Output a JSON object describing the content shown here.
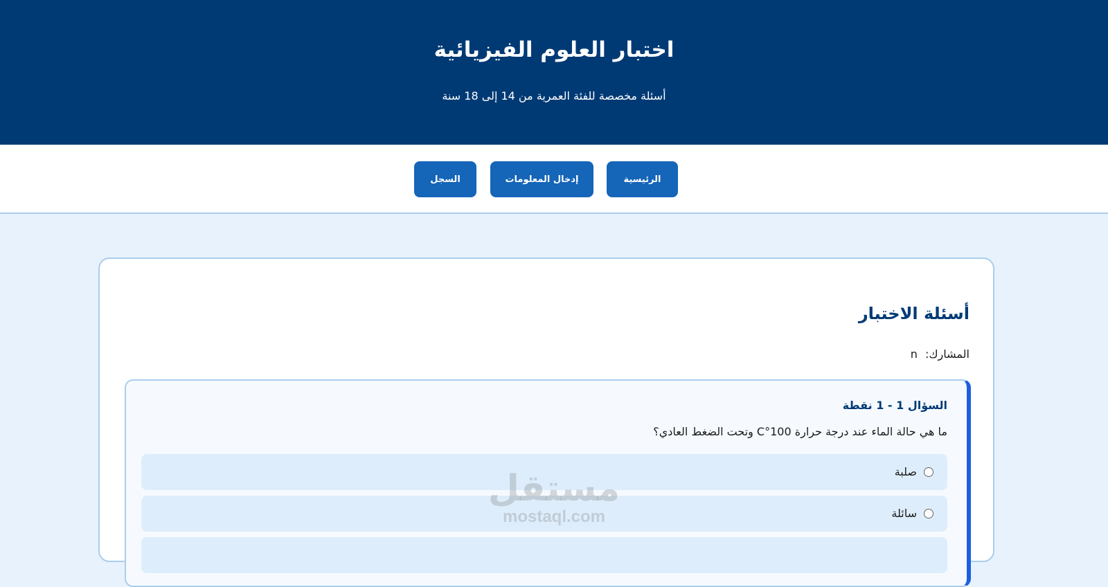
{
  "header": {
    "title": "اختبار العلوم الفيزيائية",
    "subtitle": "أسئلة مخصصة للفئة العمرية من 14 إلى 18 سنة"
  },
  "nav": {
    "home_label": "الرئيسية",
    "input_label": "إدخال المعلومات",
    "log_label": "السجل"
  },
  "quiz": {
    "title": "أسئلة الاختبار",
    "participant_label": "المشارك:",
    "participant_name": "n",
    "question": {
      "header": "السؤال 1 - 1 نقطة",
      "text": "ما هي حالة الماء عند درجة حرارة 100°C وتحت الضغط العادي؟",
      "options": [
        {
          "label": "صلبة"
        },
        {
          "label": "سائلة"
        },
        {
          "label": ""
        }
      ]
    }
  },
  "watermark": {
    "logo_text": "مستقل",
    "domain": "mostaql.com"
  }
}
